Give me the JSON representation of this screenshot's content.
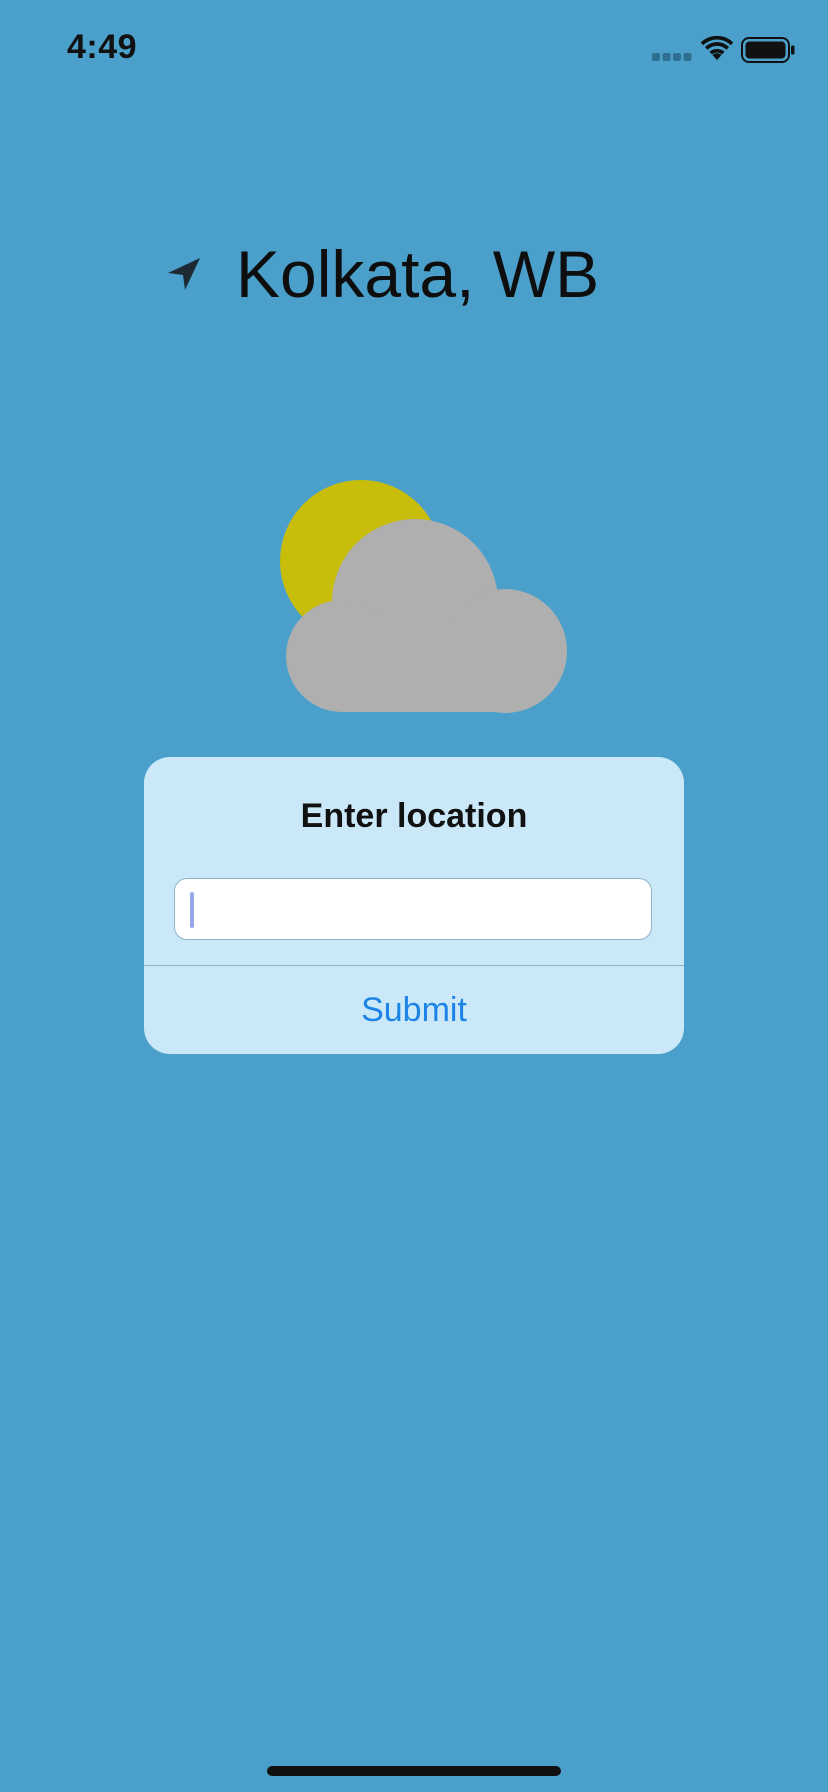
{
  "status_bar": {
    "time": "4:49",
    "signal_icon": "cellular-signal-icon",
    "wifi_icon": "wifi-icon",
    "battery_icon": "battery-icon"
  },
  "location": {
    "icon": "location-arrow-icon",
    "city": "Kolkata, WB"
  },
  "weather": {
    "icon": "partly-cloudy-icon",
    "sun_color": "#c9bd0c",
    "cloud_color": "#afafaf"
  },
  "dialog": {
    "title": "Enter location",
    "input_value": "",
    "submit_label": "Submit"
  },
  "colors": {
    "background": "#4aa0ca",
    "dialog_background": "#cae8f8",
    "accent": "#1b84e6"
  }
}
